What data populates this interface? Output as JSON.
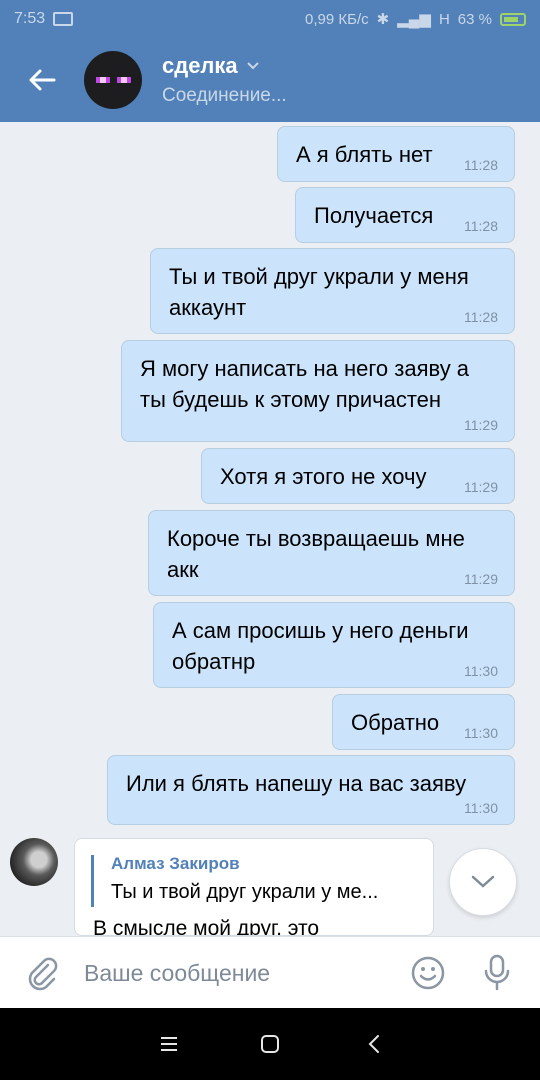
{
  "status_bar": {
    "time": "7:53",
    "speed": "0,99 КБ/с",
    "network": "H",
    "battery": "63 %"
  },
  "header": {
    "title": "сделка",
    "subtitle": "Соединение..."
  },
  "messages": [
    {
      "text_lines": [
        "А я блять нет"
      ],
      "time": "11:28"
    },
    {
      "text_lines": [
        "Получается"
      ],
      "time": "11:28"
    },
    {
      "text_lines": [
        "Ты и твой друг украли у меня",
        "аккаунт"
      ],
      "time": "11:28"
    },
    {
      "text_lines": [
        "Я могу написать на него заяву а",
        "ты будешь к этому причастен"
      ],
      "time": "11:29"
    },
    {
      "text_lines": [
        "Хотя я этого не хочу"
      ],
      "time": "11:29"
    },
    {
      "text_lines": [
        "Короче ты возвращаешь мне",
        "акк"
      ],
      "time": "11:29"
    },
    {
      "text_lines": [
        "А сам просишь у него деньги",
        "обратнр"
      ],
      "time": "11:30"
    },
    {
      "text_lines": [
        "Обратно"
      ],
      "time": "11:30"
    },
    {
      "text_lines": [
        "Или я блять напешу на вас заяву"
      ],
      "time": "11:30"
    }
  ],
  "incoming": {
    "reply_author": "Алмаз Закиров",
    "reply_text": "Ты и твой друг украли у ме...",
    "text": "В смысле мой друг, это"
  },
  "composer": {
    "placeholder": "Ваше сообщение"
  },
  "colors": {
    "header_blue": "#5181b8",
    "outgoing_bubble": "#cce4fb",
    "chat_background": "#ebeef2"
  },
  "icons": [
    "back-arrow-icon",
    "chevron-down-icon",
    "attach-icon",
    "emoji-icon",
    "microphone-icon",
    "scroll-down-icon",
    "menu-icon",
    "home-icon",
    "back-icon"
  ]
}
